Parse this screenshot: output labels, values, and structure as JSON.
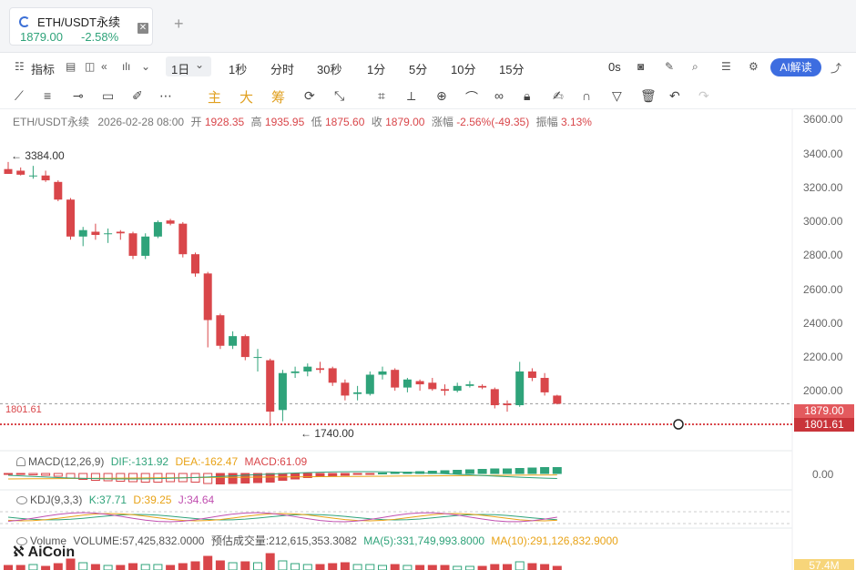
{
  "tab": {
    "pair": "ETH/USDT永续",
    "price": "1879.00",
    "change": "-2.58%",
    "close_icon": "close-icon",
    "new_tab": "+"
  },
  "toolbar1": {
    "indicators_label": "指标",
    "interval": "1日",
    "intervals": [
      "1秒",
      "分时",
      "30秒",
      "1分",
      "5分",
      "10分",
      "15分"
    ],
    "countdown": "0s",
    "ai_label": "AI解读"
  },
  "toolbar2": {
    "main_label": "主",
    "big_label": "大",
    "chip_label": "筹"
  },
  "info": {
    "symbol": "ETH/USDT永续",
    "datetime": "2026-02-28 08:00",
    "open_label": "开",
    "open": "1928.35",
    "high_label": "高",
    "high": "1935.95",
    "low_label": "低",
    "low": "1875.60",
    "close_label": "收",
    "close": "1879.00",
    "range_label": "涨幅",
    "range": "-2.56%(-49.35)",
    "amp_label": "振幅",
    "amp": "3.13%"
  },
  "axis": {
    "ticks": [
      "3600.00",
      "3400.00",
      "3200.00",
      "3000.00",
      "2800.00",
      "2600.00",
      "2400.00",
      "2200.00",
      "2000.00"
    ],
    "last_price": "1879.00",
    "cross_price": "1801.61",
    "left_price": "1801.61"
  },
  "marks": {
    "high": "← 3384.00",
    "low": "← 1740.00"
  },
  "macd": {
    "label": "MACD(12,26,9)",
    "dif": "DIF:-131.92",
    "dea": "DEA:-162.47",
    "macd": "MACD:61.09",
    "zero": "0.00"
  },
  "kdj": {
    "label": "KDJ(9,3,3)",
    "k": "K:37.71",
    "d": "D:39.25",
    "j": "J:34.64"
  },
  "volume": {
    "label": "Volume",
    "vol": "VOLUME:57,425,832.0000",
    "est": "预估成交量:212,615,353.3082",
    "ma5": "MA(5):331,749,993.8000",
    "ma10": "MA(10):291,126,832.9000",
    "tag": "57.4M"
  },
  "watermark": "AiCoin",
  "colors": {
    "up": "#2fa37a",
    "down": "#d9464a",
    "accent": "#3d6de0"
  },
  "chart_data": {
    "type": "candlestick",
    "candles": [
      {
        "o": 3340,
        "h": 3384,
        "l": 3310,
        "c": 3310
      },
      {
        "o": 3330,
        "h": 3350,
        "l": 3300,
        "c": 3305
      },
      {
        "o": 3300,
        "h": 3360,
        "l": 3280,
        "c": 3300
      },
      {
        "o": 3300,
        "h": 3330,
        "l": 3260,
        "c": 3270
      },
      {
        "o": 3260,
        "h": 3270,
        "l": 3140,
        "c": 3150
      },
      {
        "o": 3150,
        "h": 3160,
        "l": 2900,
        "c": 2920
      },
      {
        "o": 2920,
        "h": 2980,
        "l": 2860,
        "c": 2960
      },
      {
        "o": 2950,
        "h": 3000,
        "l": 2900,
        "c": 2930
      },
      {
        "o": 2940,
        "h": 2970,
        "l": 2880,
        "c": 2940
      },
      {
        "o": 2950,
        "h": 2960,
        "l": 2900,
        "c": 2940
      },
      {
        "o": 2940,
        "h": 2950,
        "l": 2780,
        "c": 2800
      },
      {
        "o": 2800,
        "h": 2940,
        "l": 2780,
        "c": 2920
      },
      {
        "o": 2920,
        "h": 3020,
        "l": 2910,
        "c": 3010
      },
      {
        "o": 3020,
        "h": 3030,
        "l": 2990,
        "c": 3000
      },
      {
        "o": 3000,
        "h": 3010,
        "l": 2790,
        "c": 2810
      },
      {
        "o": 2810,
        "h": 2820,
        "l": 2670,
        "c": 2690
      },
      {
        "o": 2690,
        "h": 2700,
        "l": 2230,
        "c": 2400
      },
      {
        "o": 2430,
        "h": 2440,
        "l": 2220,
        "c": 2240
      },
      {
        "o": 2240,
        "h": 2330,
        "l": 2220,
        "c": 2300
      },
      {
        "o": 2300,
        "h": 2310,
        "l": 2150,
        "c": 2170
      },
      {
        "o": 2170,
        "h": 2220,
        "l": 2080,
        "c": 2170
      },
      {
        "o": 2150,
        "h": 2160,
        "l": 1740,
        "c": 1830
      },
      {
        "o": 1840,
        "h": 2090,
        "l": 1770,
        "c": 2070
      },
      {
        "o": 2070,
        "h": 2110,
        "l": 2040,
        "c": 2080
      },
      {
        "o": 2080,
        "h": 2130,
        "l": 2050,
        "c": 2110
      },
      {
        "o": 2100,
        "h": 2140,
        "l": 2070,
        "c": 2090
      },
      {
        "o": 2100,
        "h": 2110,
        "l": 1990,
        "c": 2010
      },
      {
        "o": 2010,
        "h": 2030,
        "l": 1900,
        "c": 1930
      },
      {
        "o": 1940,
        "h": 1990,
        "l": 1900,
        "c": 1950
      },
      {
        "o": 1940,
        "h": 2080,
        "l": 1930,
        "c": 2060
      },
      {
        "o": 2060,
        "h": 2110,
        "l": 2030,
        "c": 2080
      },
      {
        "o": 2090,
        "h": 2100,
        "l": 1960,
        "c": 1980
      },
      {
        "o": 1980,
        "h": 2040,
        "l": 1950,
        "c": 2030
      },
      {
        "o": 2020,
        "h": 2030,
        "l": 1960,
        "c": 2000
      },
      {
        "o": 2010,
        "h": 2040,
        "l": 1960,
        "c": 1970
      },
      {
        "o": 1970,
        "h": 2000,
        "l": 1930,
        "c": 1960
      },
      {
        "o": 1960,
        "h": 2010,
        "l": 1950,
        "c": 1990
      },
      {
        "o": 1990,
        "h": 2020,
        "l": 1980,
        "c": 2000
      },
      {
        "o": 1990,
        "h": 2000,
        "l": 1970,
        "c": 1980
      },
      {
        "o": 1970,
        "h": 1980,
        "l": 1850,
        "c": 1870
      },
      {
        "o": 1880,
        "h": 1900,
        "l": 1830,
        "c": 1870
      },
      {
        "o": 1870,
        "h": 2140,
        "l": 1860,
        "c": 2080
      },
      {
        "o": 2080,
        "h": 2100,
        "l": 2020,
        "c": 2040
      },
      {
        "o": 2040,
        "h": 2070,
        "l": 1930,
        "c": 1950
      },
      {
        "o": 1930,
        "h": 1935,
        "l": 1875,
        "c": 1879
      }
    ],
    "ylim": [
      1700,
      3650
    ],
    "macd_hist": [
      -2,
      -4,
      -6,
      -8,
      -12,
      -20,
      -26,
      -30,
      -32,
      -34,
      -36,
      -38,
      -38,
      -36,
      -36,
      -38,
      -44,
      -46,
      -44,
      -42,
      -40,
      -38,
      -30,
      -24,
      -18,
      -14,
      -10,
      -8,
      -4,
      -2,
      2,
      4,
      6,
      8,
      10,
      12,
      14,
      16,
      18,
      20,
      20,
      22,
      24,
      26,
      26
    ],
    "volume": [
      5,
      5,
      6,
      4,
      7,
      12,
      8,
      6,
      5,
      5,
      7,
      6,
      6,
      5,
      7,
      9,
      15,
      10,
      8,
      9,
      8,
      18,
      10,
      7,
      6,
      6,
      7,
      8,
      6,
      6,
      5,
      6,
      5,
      5,
      5,
      5,
      4,
      4,
      4,
      6,
      6,
      9,
      7,
      6,
      4
    ]
  }
}
